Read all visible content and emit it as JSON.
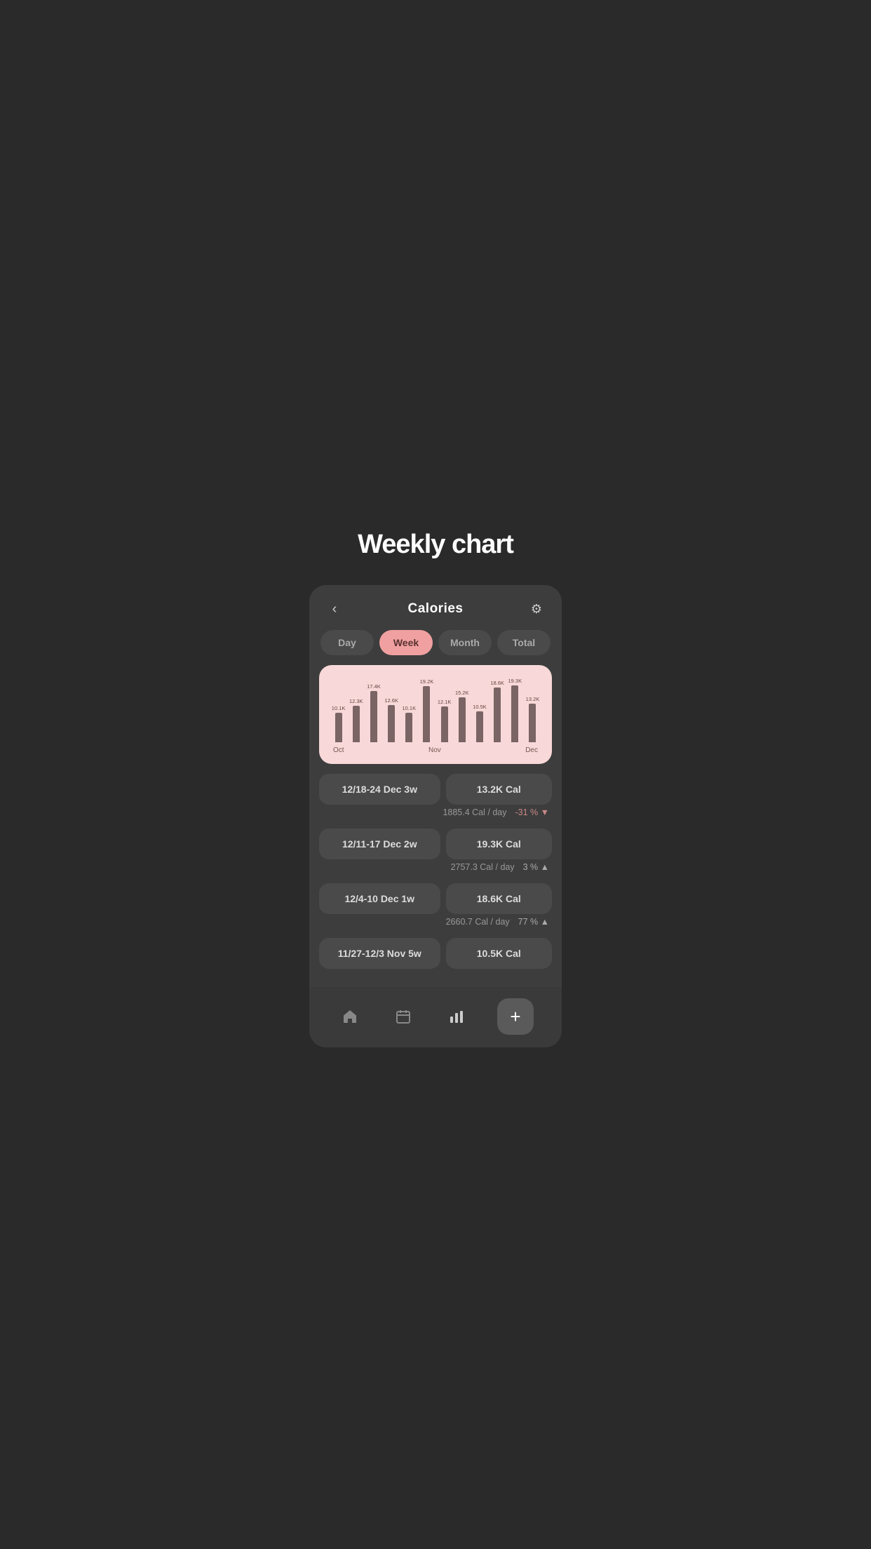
{
  "page": {
    "title": "Weekly chart",
    "bg_color": "#2a2a2a"
  },
  "header": {
    "back_label": "‹",
    "title": "Calories",
    "settings_icon": "⚙"
  },
  "tabs": [
    {
      "id": "day",
      "label": "Day",
      "active": false
    },
    {
      "id": "week",
      "label": "Week",
      "active": true
    },
    {
      "id": "month",
      "label": "Month",
      "active": false
    },
    {
      "id": "total",
      "label": "Total",
      "active": false
    }
  ],
  "chart": {
    "bars": [
      {
        "label": "10.1K",
        "height": 42,
        "show_label": true
      },
      {
        "label": "12.3K",
        "height": 52,
        "show_label": true
      },
      {
        "label": "17.4K",
        "height": 73,
        "show_label": true
      },
      {
        "label": "12.6K",
        "height": 53,
        "show_label": true
      },
      {
        "label": "10.1K",
        "height": 42,
        "show_label": true
      },
      {
        "label": "19.2K",
        "height": 80,
        "show_label": true
      },
      {
        "label": "12.1K",
        "height": 51,
        "show_label": true
      },
      {
        "label": "15.2K",
        "height": 64,
        "show_label": true
      },
      {
        "label": "10.5K",
        "height": 44,
        "show_label": true
      },
      {
        "label": "18.6K",
        "height": 78,
        "show_label": true
      },
      {
        "label": "19.3K",
        "height": 81,
        "show_label": true
      },
      {
        "label": "13.2K",
        "height": 55,
        "show_label": true
      }
    ],
    "x_labels": [
      {
        "label": "Oct",
        "position": "left"
      },
      {
        "label": "Nov",
        "position": "center"
      },
      {
        "label": "Dec",
        "position": "right"
      }
    ]
  },
  "weeks": [
    {
      "date_range": "12/18-24",
      "week_label": "Dec 3w",
      "calories": "13.2K Cal",
      "cal_per_day": "1885.4 Cal / day",
      "change": "-31 %",
      "change_dir": "down"
    },
    {
      "date_range": "12/11-17",
      "week_label": "Dec 2w",
      "calories": "19.3K Cal",
      "cal_per_day": "2757.3 Cal / day",
      "change": "3 %",
      "change_dir": "up"
    },
    {
      "date_range": "12/4-10",
      "week_label": "Dec 1w",
      "calories": "18.6K Cal",
      "cal_per_day": "2660.7 Cal / day",
      "change": "77 %",
      "change_dir": "up"
    },
    {
      "date_range": "11/27-12/3",
      "week_label": "Nov 5w",
      "calories": "10.5K Cal",
      "cal_per_day": "",
      "change": "",
      "change_dir": ""
    }
  ],
  "nav": {
    "home_icon": "⌂",
    "calendar_icon": "▦",
    "chart_icon": "▐▐▐",
    "add_icon": "+"
  }
}
